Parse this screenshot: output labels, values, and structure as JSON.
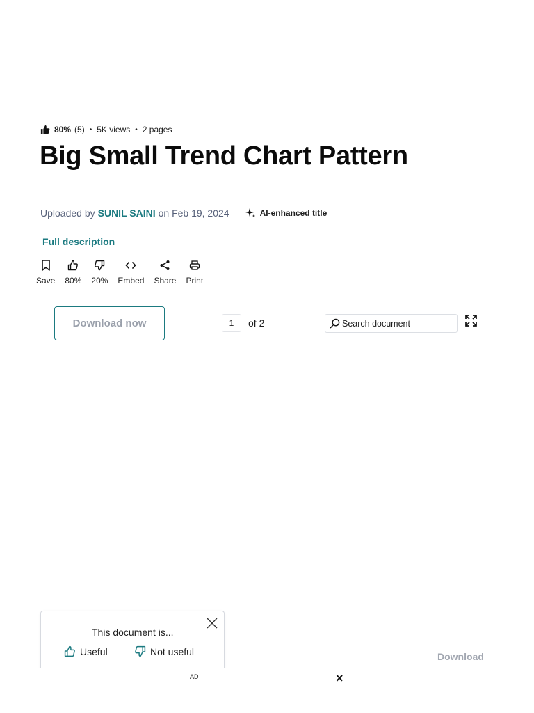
{
  "meta": {
    "rating_pct": "80%",
    "rating_count": "(5)",
    "separator": "•",
    "views": "5K views",
    "pages": "2 pages"
  },
  "document": {
    "title": "Big Small Trend Chart Pattern",
    "uploaded_by_label": "Uploaded by",
    "author": "SUNIL SAINI",
    "date_text": "on Feb 19, 2024",
    "ai_badge": "AI-enhanced title",
    "full_description_link": "Full description"
  },
  "actions": [
    {
      "label": "Save",
      "icon": "bookmark-icon"
    },
    {
      "label": "80%",
      "icon": "thumbs-up-icon"
    },
    {
      "label": "20%",
      "icon": "thumbs-down-icon"
    },
    {
      "label": "Embed",
      "icon": "code-icon"
    },
    {
      "label": "Share",
      "icon": "share-icon"
    },
    {
      "label": "Print",
      "icon": "printer-icon"
    }
  ],
  "viewer": {
    "download_now": "Download now",
    "current_page": "1",
    "of_pages": "of 2",
    "search_placeholder": "Search document"
  },
  "feedback": {
    "question": "This document is...",
    "useful": "Useful",
    "not_useful": "Not useful"
  },
  "bottom": {
    "download": "Download",
    "ad_label": "AD",
    "ad_close": "×"
  },
  "colors": {
    "accent": "#1b7a80",
    "muted_text": "#57617a",
    "disabled_text": "#9aa0ab"
  }
}
